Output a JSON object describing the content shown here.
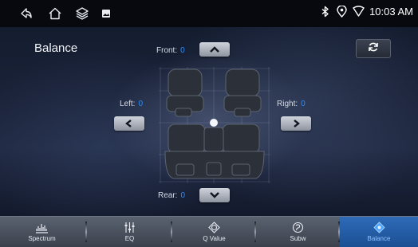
{
  "status_bar": {
    "time": "10:03 AM",
    "icons": [
      "back-icon",
      "home-icon",
      "layers-icon",
      "image-icon",
      "bluetooth-icon",
      "location-icon",
      "wifi-icon"
    ]
  },
  "page": {
    "title": "Balance"
  },
  "balance": {
    "front_label": "Front:",
    "front_value": "0",
    "rear_label": "Rear:",
    "rear_value": "0",
    "left_label": "Left:",
    "left_value": "0",
    "right_label": "Right:",
    "right_value": "0"
  },
  "bottom_nav": {
    "tabs": [
      {
        "label": "Spectrum",
        "icon": "spectrum-icon"
      },
      {
        "label": "EQ",
        "icon": "eq-sliders-icon"
      },
      {
        "label": "Q Value",
        "icon": "q-value-icon"
      },
      {
        "label": "Subw",
        "icon": "subwoofer-icon"
      },
      {
        "label": "Balance",
        "icon": "balance-icon"
      }
    ],
    "active": "Balance"
  },
  "colors": {
    "accent": "#2c8cff",
    "active_tab": "#2e6bb8",
    "status_bar": "#07090f"
  }
}
